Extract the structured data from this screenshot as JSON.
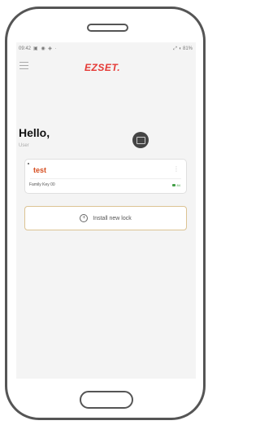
{
  "status": {
    "time": "09:42",
    "icons": "▣ ◉ ◈ ·",
    "right": "⤢ ◖ 81%"
  },
  "header": {
    "brand": "EZSET."
  },
  "greeting": {
    "title": "Hello,",
    "subtitle": "User"
  },
  "locks": [
    {
      "name": "test",
      "key_label": "Family Key 00",
      "battery_text": "84"
    }
  ],
  "actions": {
    "install_label": "Install new lock"
  },
  "colors": {
    "brand": "#e53935",
    "lock_name": "#d64d1f",
    "battery": "#43a047",
    "install_border": "#dcc393"
  }
}
